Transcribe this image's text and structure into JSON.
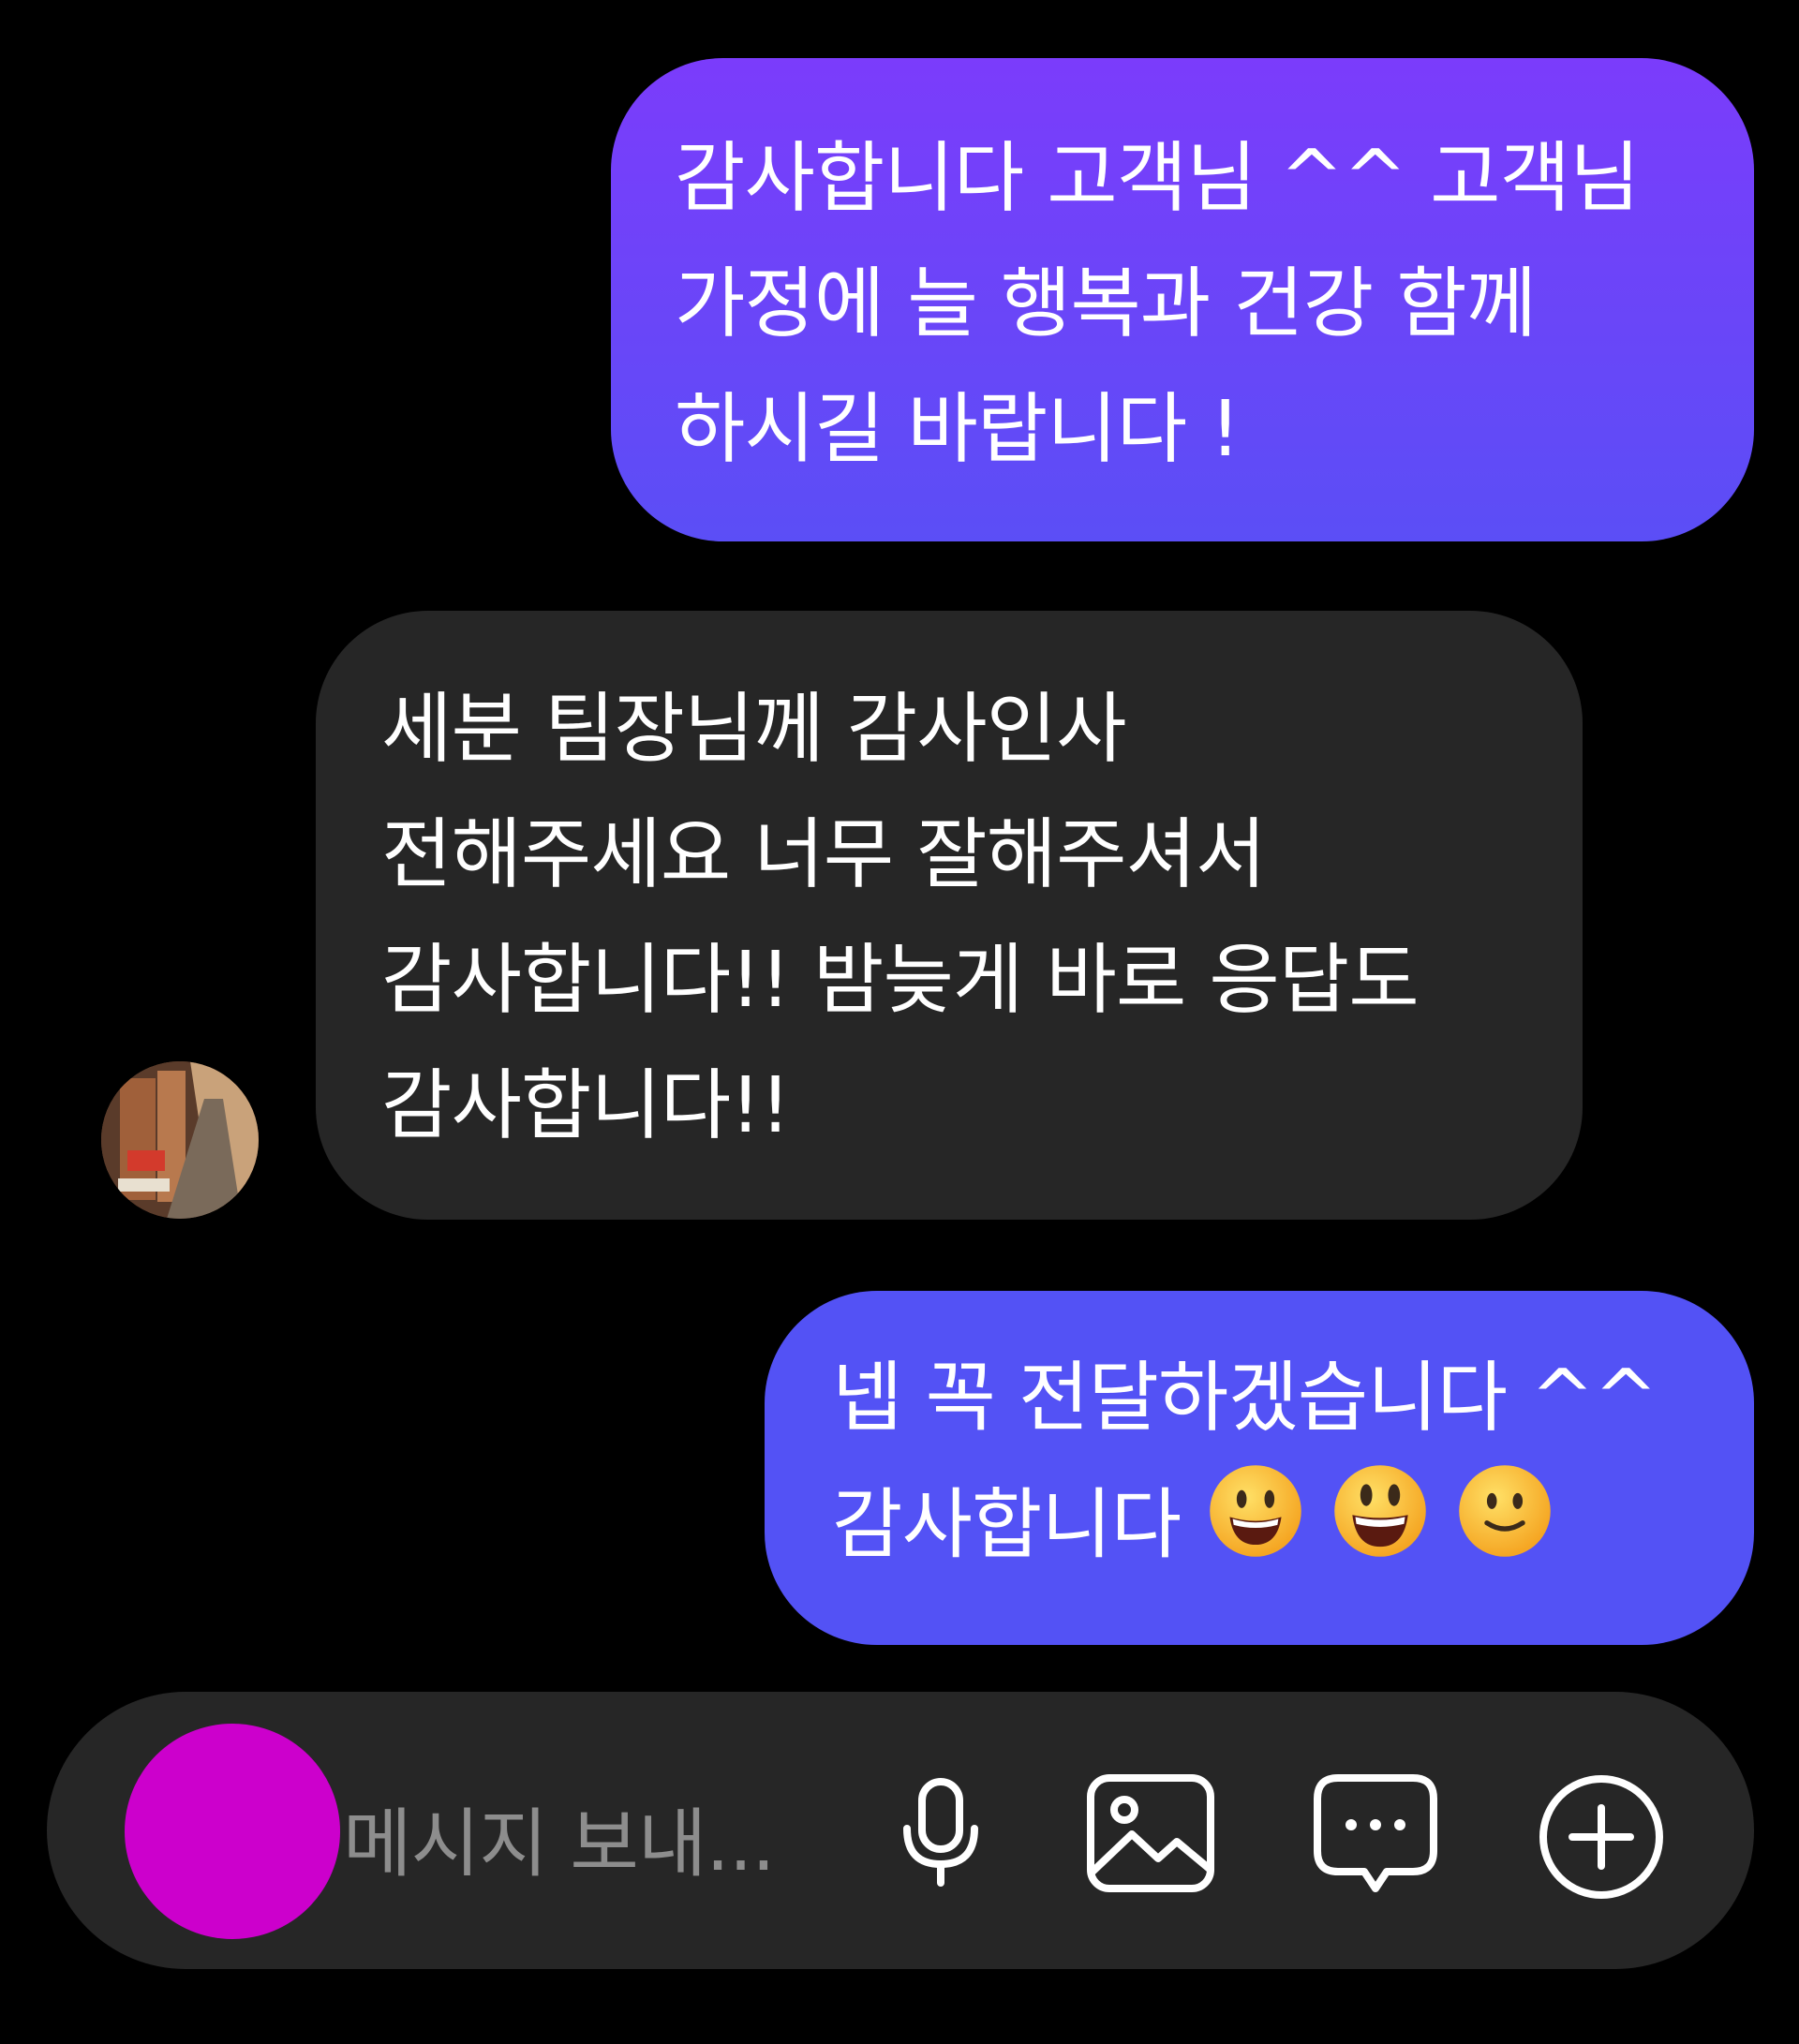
{
  "colors": {
    "background": "#000000",
    "outgoing_bubble_top": "#7b3cfb",
    "outgoing_bubble_bottom": "#5352f5",
    "incoming_bubble": "#262626",
    "composer_bg": "#262626",
    "camera_button": "#cc00cc"
  },
  "messages": [
    {
      "direction": "outgoing",
      "lines": [
        "감사합니다 고객님 ^^ 고객님",
        "가정에 늘 행복과 건강 함께",
        "하시길 바랍니다 !"
      ]
    },
    {
      "direction": "incoming",
      "lines": [
        "세분 팀장님께 감사인사",
        "전해주세요 너무 잘해주셔서",
        "감사합니다!! 밤늦게 바로 응답도",
        "감사합니다!!"
      ]
    },
    {
      "direction": "outgoing",
      "lines": [
        "넵 꼭 전달하겠습니다 ^^",
        "감사합니다"
      ],
      "emojis": [
        "grinning-face-icon",
        "smiley-face-icon",
        "slightly-smiling-face-icon"
      ]
    }
  ],
  "composer": {
    "placeholder": "메시지 보내...",
    "icons": [
      "camera-button",
      "microphone-icon",
      "image-icon",
      "sticker-chat-icon",
      "plus-circle-icon"
    ]
  }
}
